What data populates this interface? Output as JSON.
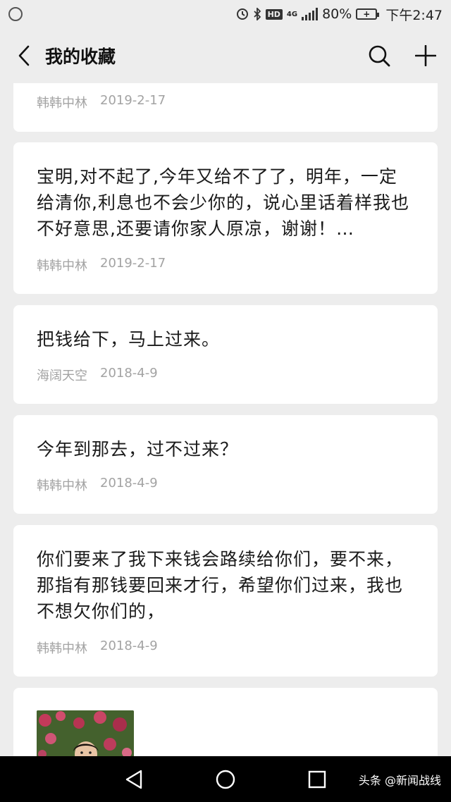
{
  "status_bar": {
    "battery_percent": "80%",
    "time": "下午2:47",
    "hd_label": "HD",
    "network_label": "4G"
  },
  "nav": {
    "title": "我的收藏"
  },
  "favorites": [
    {
      "text": "",
      "author": "韩韩中林",
      "date": "2019-2-17"
    },
    {
      "text": "宝明,对不起了,今年又给不了了，明年，一定给清你,利息也不会少你的，说心里话着样我也不好意思,还要请你家人原凉，谢谢！…",
      "author": "韩韩中林",
      "date": "2019-2-17"
    },
    {
      "text": "把钱给下，马上过来。",
      "author": "海阔天空",
      "date": "2018-4-9"
    },
    {
      "text": "今年到那去，过不过来？",
      "author": "韩韩中林",
      "date": "2018-4-9"
    },
    {
      "text": "你们要来了我下来钱会路续给你们，要不来，那指有那钱要回来才行，希望你们过来，我也不想欠你们的，",
      "author": "韩韩中林",
      "date": "2018-4-9"
    }
  ],
  "watermark": "头条 @新闻战线",
  "colors": {
    "background": "#ededed",
    "card": "#ffffff",
    "meta_text": "#a3a3a3",
    "system_bar": "#000000"
  }
}
